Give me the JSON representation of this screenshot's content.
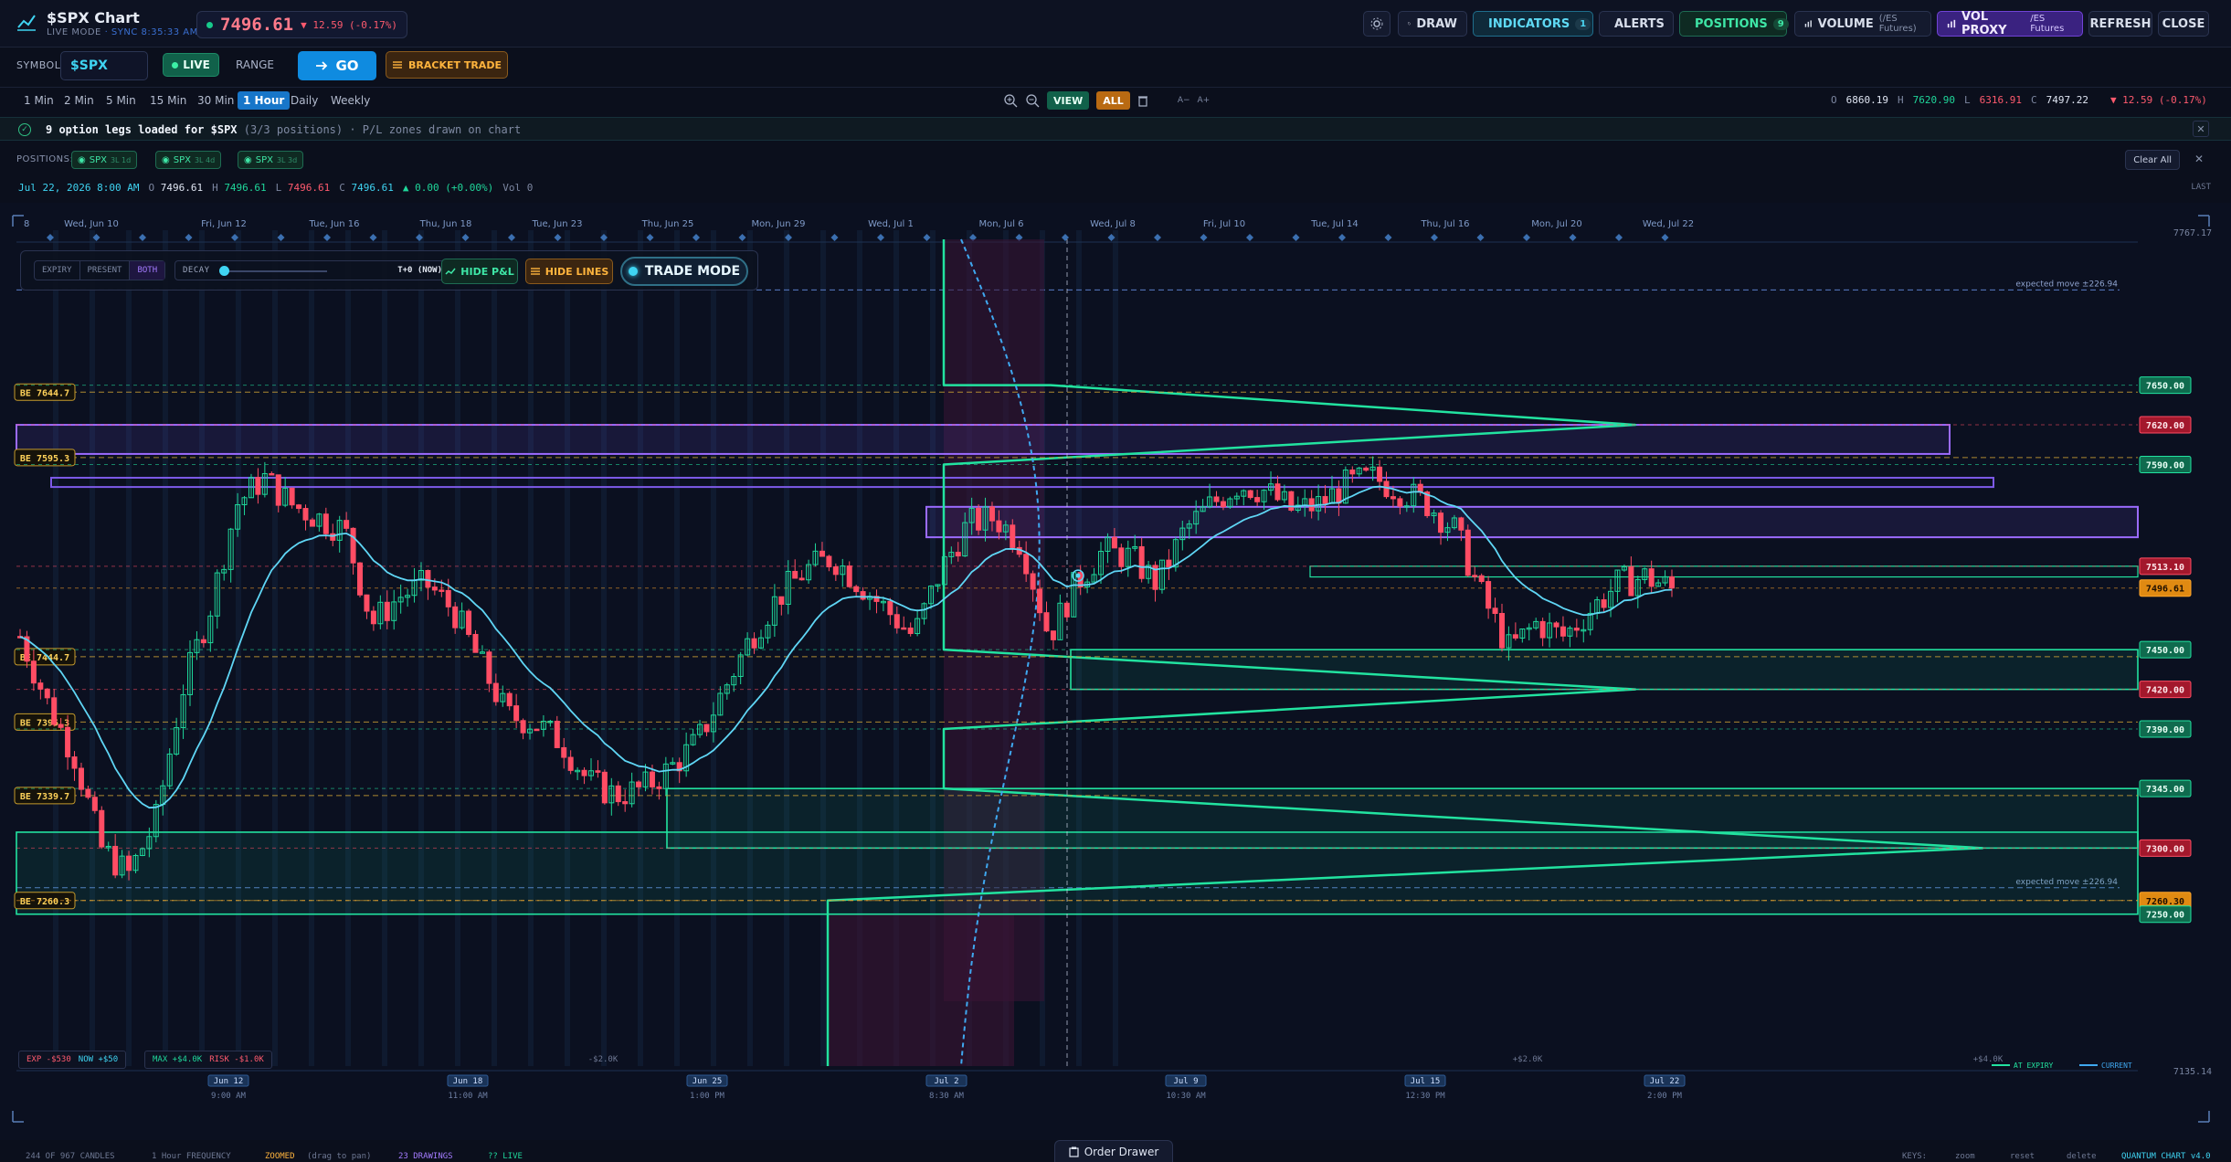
{
  "header": {
    "title": "$SPX Chart",
    "mode": "LIVE MODE",
    "sync": "· SYNC 8:35:33 AM",
    "price": "7496.61",
    "change": "▼ 12.59 (-0.17%)",
    "buttons": {
      "draw": "DRAW",
      "indicators": "INDICATORS",
      "indicators_count": "1",
      "alerts": "ALERTS",
      "positions": "POSITIONS",
      "positions_count": "9",
      "volume": "VOLUME",
      "volume_sub": "(/ES Futures)",
      "volproxy": "VOL PROXY",
      "volproxy_sub": "/ES Futures",
      "refresh": "REFRESH",
      "close": "CLOSE"
    }
  },
  "toolbar": {
    "symbol_label": "SYMBOL",
    "symbol_value": "$SPX",
    "live": "LIVE",
    "range": "RANGE",
    "go": "GO",
    "bracket": "BRACKET TRADE"
  },
  "timeframes": [
    "1 Min",
    "2 Min",
    "5 Min",
    "15 Min",
    "30 Min",
    "1 Hour",
    "Daily",
    "Weekly"
  ],
  "timeframe_active": "1 Hour",
  "tools": {
    "zoom_in": "+",
    "zoom_out": "−",
    "view": "VIEW",
    "all": "ALL",
    "font_small": "A−",
    "font_big": "A+"
  },
  "ohlc_top": {
    "o_k": "O",
    "o": "6860.19",
    "h_k": "H",
    "h": "7620.90",
    "l_k": "L",
    "l": "6316.91",
    "c_k": "C",
    "c": "7497.22",
    "chg": "▼ 12.59 (-0.17%)"
  },
  "notice": {
    "lead": "9 option legs loaded for $SPX",
    "count": "(3/3 positions)",
    "tail": "· P/L zones drawn on chart"
  },
  "positions": {
    "label": "POSITIONS:",
    "chips": [
      {
        "name": "SPX",
        "sub": "3L 1d"
      },
      {
        "name": "SPX",
        "sub": "3L 4d"
      },
      {
        "name": "SPX",
        "sub": "3L 3d"
      }
    ],
    "clear_all": "Clear All"
  },
  "ohlc_line": {
    "date": "Jul 22, 2026 8:00 AM",
    "o_k": "O",
    "o": "7496.61",
    "h_k": "H",
    "h": "7496.61",
    "l_k": "L",
    "l": "7496.61",
    "c_k": "C",
    "c": "7496.61",
    "chg": "▲ 0.00 (+0.00%)",
    "vol": "Vol 0",
    "last": "LAST"
  },
  "controls": {
    "expiry": "EXPIRY",
    "present": "PRESENT",
    "both": "BOTH",
    "decay": "DECAY",
    "decay_now": "T+0 (NOW)",
    "decay_level": 0,
    "hide_pl": "HIDE P&L",
    "hide_lines": "HIDE LINES",
    "trade_mode": "TRADE MODE"
  },
  "pnl": {
    "exp": "EXP -$530",
    "now": "NOW +$50",
    "max": "MAX +$4.0K",
    "risk": "RISK -$1.0K",
    "left_tick": "-$2.0K",
    "mid_tick": "+$2.0K",
    "right_tick": "+$4.0K",
    "legend_expiry": "AT EXPIRY",
    "legend_current": "CURRENT"
  },
  "drawer": {
    "label": "Order Drawer"
  },
  "status": {
    "candles": "244 OF 967 CANDLES",
    "freq": "1 Hour FREQUENCY",
    "zoomed": "ZOOMED",
    "zoomed_hint": "(drag to pan)",
    "drawings": "23 DRAWINGS",
    "live": "?? LIVE",
    "keys": "KEYS:",
    "k1": "zoom",
    "k2": "reset",
    "k3": "delete",
    "version": "QUANTUM CHART v4.0"
  },
  "chart_data": {
    "type": "candlestick",
    "colors": {
      "up": "#1fd69a",
      "down": "#ff4d64",
      "ema": "#5fd6f5",
      "zone": "#8b5cf6",
      "pnl": "#22e3a0"
    },
    "y_top": "7767.17",
    "y_bottom": "7135.14",
    "ylim": [
      7135.14,
      7767.17
    ],
    "top_dates": [
      "Wed, Jun 10",
      "Fri, Jun 12",
      "Tue, Jun 16",
      "Thu, Jun 18",
      "Tue, Jun 23",
      "Thu, Jun 25",
      "Mon, Jun 29",
      "Wed, Jul 1",
      "Mon, Jul 6",
      "Wed, Jul 8",
      "Fri, Jul 10",
      "Tue, Jul 14",
      "Thu, Jul 16",
      "Mon, Jul 20",
      "Wed, Jul 22"
    ],
    "bottom_ticks": [
      {
        "d": "Jun 12",
        "t": "9:00 AM"
      },
      {
        "d": "Jun 18",
        "t": "11:00 AM"
      },
      {
        "d": "Jun 25",
        "t": "1:00 PM"
      },
      {
        "d": "Jul 2",
        "t": "8:30 AM"
      },
      {
        "d": "Jul 9",
        "t": "10:30 AM"
      },
      {
        "d": "Jul 15",
        "t": "12:30 PM"
      },
      {
        "d": "Jul 22",
        "t": "2:00 PM"
      }
    ],
    "be_levels": [
      7644.7,
      7595.3,
      7444.7,
      7395.3,
      7339.7,
      7260.3
    ],
    "be_labels": [
      "BE 7644.7",
      "BE 7595.3",
      "BE 7444.7",
      "BE 7395.3",
      "BE 7339.7",
      "BE 7260.3"
    ],
    "strike_labels": [
      {
        "v": 7650.0,
        "text": "7650.00",
        "c": "green"
      },
      {
        "v": 7620.0,
        "text": "7620.00",
        "c": "red"
      },
      {
        "v": 7590.0,
        "text": "7590.00",
        "c": "green"
      },
      {
        "v": 7513.1,
        "text": "7513.10",
        "c": "red"
      },
      {
        "v": 7496.61,
        "text": "7496.61",
        "c": "orange"
      },
      {
        "v": 7450.0,
        "text": "7450.00",
        "c": "green"
      },
      {
        "v": 7420.0,
        "text": "7420.00",
        "c": "red"
      },
      {
        "v": 7390.0,
        "text": "7390.00",
        "c": "green"
      },
      {
        "v": 7345.0,
        "text": "7345.00",
        "c": "green"
      },
      {
        "v": 7300.0,
        "text": "7300.00",
        "c": "red"
      },
      {
        "v": 7260.3,
        "text": "7260.30",
        "c": "orange"
      },
      {
        "v": 7250.0,
        "text": "7250.00",
        "c": "green"
      }
    ],
    "expected_move": "expected move ±226.94",
    "expected_move_high": 7722.0,
    "expected_move_low": 7270.0,
    "candles_count": 244,
    "close_path": [
      7460,
      7410,
      7370,
      7300,
      7280,
      7320,
      7420,
      7480,
      7560,
      7580,
      7560,
      7550,
      7540,
      7470,
      7490,
      7500,
      7480,
      7440,
      7400,
      7395,
      7380,
      7350,
      7340,
      7345,
      7360,
      7380,
      7420,
      7460,
      7490,
      7510,
      7520,
      7500,
      7480,
      7460,
      7510,
      7545,
      7550,
      7530,
      7460,
      7500,
      7525,
      7520,
      7500,
      7540,
      7560,
      7575,
      7570,
      7555,
      7560,
      7575,
      7580,
      7570,
      7560,
      7540,
      7490,
      7450,
      7470,
      7460,
      7480,
      7500,
      7505,
      7496.61
    ]
  }
}
